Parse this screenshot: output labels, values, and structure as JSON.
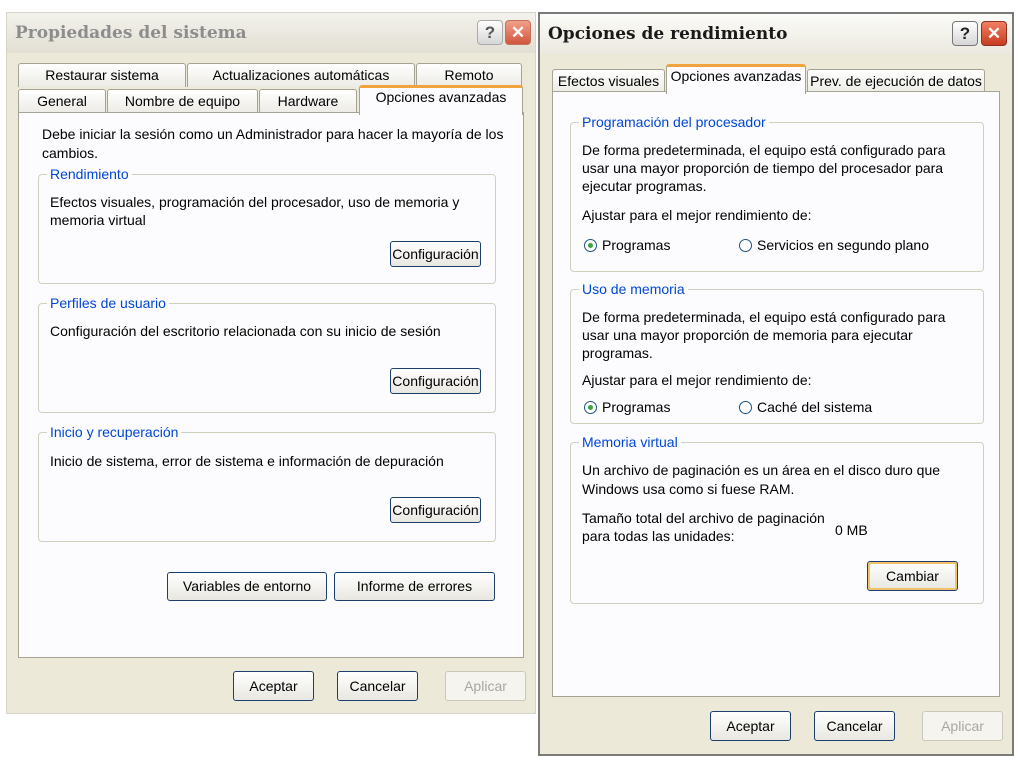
{
  "system_props": {
    "title": "Propiedades del sistema",
    "tabs_row1": [
      "Restaurar sistema",
      "Actualizaciones automáticas",
      "Remoto"
    ],
    "tabs_row2": [
      "General",
      "Nombre de equipo",
      "Hardware",
      "Opciones avanzadas"
    ],
    "intro_line1": "Debe iniciar la sesión como un Administrador para hacer la mayoría de los",
    "intro_line2": "cambios.",
    "performance": {
      "legend": "Rendimiento",
      "line1": "Efectos visuales, programación del procesador, uso de memoria y",
      "line2": "memoria virtual",
      "button": "Configuración"
    },
    "profiles": {
      "legend": "Perfiles de usuario",
      "line1": "Configuración del escritorio relacionada con su inicio de sesión",
      "button": "Configuración"
    },
    "startup": {
      "legend": "Inicio y recuperación",
      "line1": "Inicio de sistema, error de sistema e información de depuración",
      "button": "Configuración"
    },
    "env_button": "Variables de entorno",
    "error_button": "Informe de errores",
    "ok": "Aceptar",
    "cancel": "Cancelar",
    "apply": "Aplicar"
  },
  "perf_options": {
    "title": "Opciones de rendimiento",
    "tabs": [
      "Efectos visuales",
      "Opciones avanzadas",
      "Prev. de ejecución de datos"
    ],
    "processor": {
      "legend": "Programación del procesador",
      "line1": "De forma predeterminada, el equipo está configurado para",
      "line2": "usar una mayor proporción de tiempo del procesador para",
      "line3": "ejecutar programas.",
      "adjust": "Ajustar para el mejor rendimiento de:",
      "opt1": "Programas",
      "opt2": "Servicios en segundo plano"
    },
    "memory": {
      "legend": "Uso de memoria",
      "line1": "De forma predeterminada, el equipo está configurado para",
      "line2": "usar una mayor proporción de memoria para ejecutar",
      "line3": "programas.",
      "adjust": "Ajustar para el mejor rendimiento de:",
      "opt1": "Programas",
      "opt2": "Caché del sistema"
    },
    "virtual": {
      "legend": "Memoria virtual",
      "line1": "Un archivo de paginación es un área en el disco duro que",
      "line2": "Windows usa como si fuese RAM.",
      "size_line1": "Tamaño total del archivo de paginación",
      "size_line2": "para todas las unidades:",
      "size_value": "0 MB",
      "button": "Cambiar"
    },
    "ok": "Aceptar",
    "cancel": "Cancelar",
    "apply": "Aplicar"
  }
}
